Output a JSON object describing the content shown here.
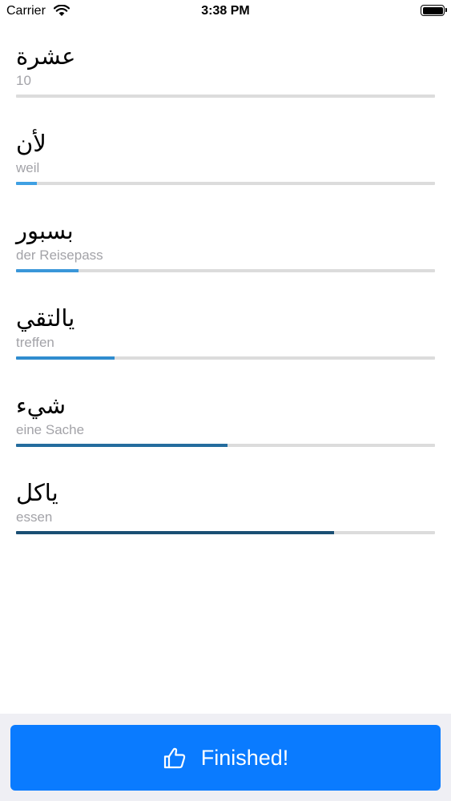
{
  "status_bar": {
    "carrier": "Carrier",
    "time": "3:38 PM",
    "wifi_icon": "wifi-icon",
    "battery_icon": "battery-icon"
  },
  "words": [
    {
      "arabic": "عشرة",
      "translation": "10",
      "progress": 0.0
    },
    {
      "arabic": "لأن",
      "translation": "weil",
      "progress": 0.05
    },
    {
      "arabic": "بسبور",
      "translation": "der Reisepass",
      "progress": 0.15
    },
    {
      "arabic": "يالتقي",
      "translation": "treffen",
      "progress": 0.235
    },
    {
      "arabic": "شيء",
      "translation": "eine Sache",
      "progress": 0.505
    },
    {
      "arabic": "ياكل",
      "translation": "essen",
      "progress": 0.76
    }
  ],
  "progress_colors": [
    "#3fa0e3",
    "#3fa0e3",
    "#3a97d9",
    "#2f8ccf",
    "#246c9e",
    "#1a4f73"
  ],
  "track_color": "#dcdcdc",
  "finish_button": {
    "label": "Finished!",
    "icon": "thumbs-up-icon",
    "color": "#0a7bff"
  }
}
